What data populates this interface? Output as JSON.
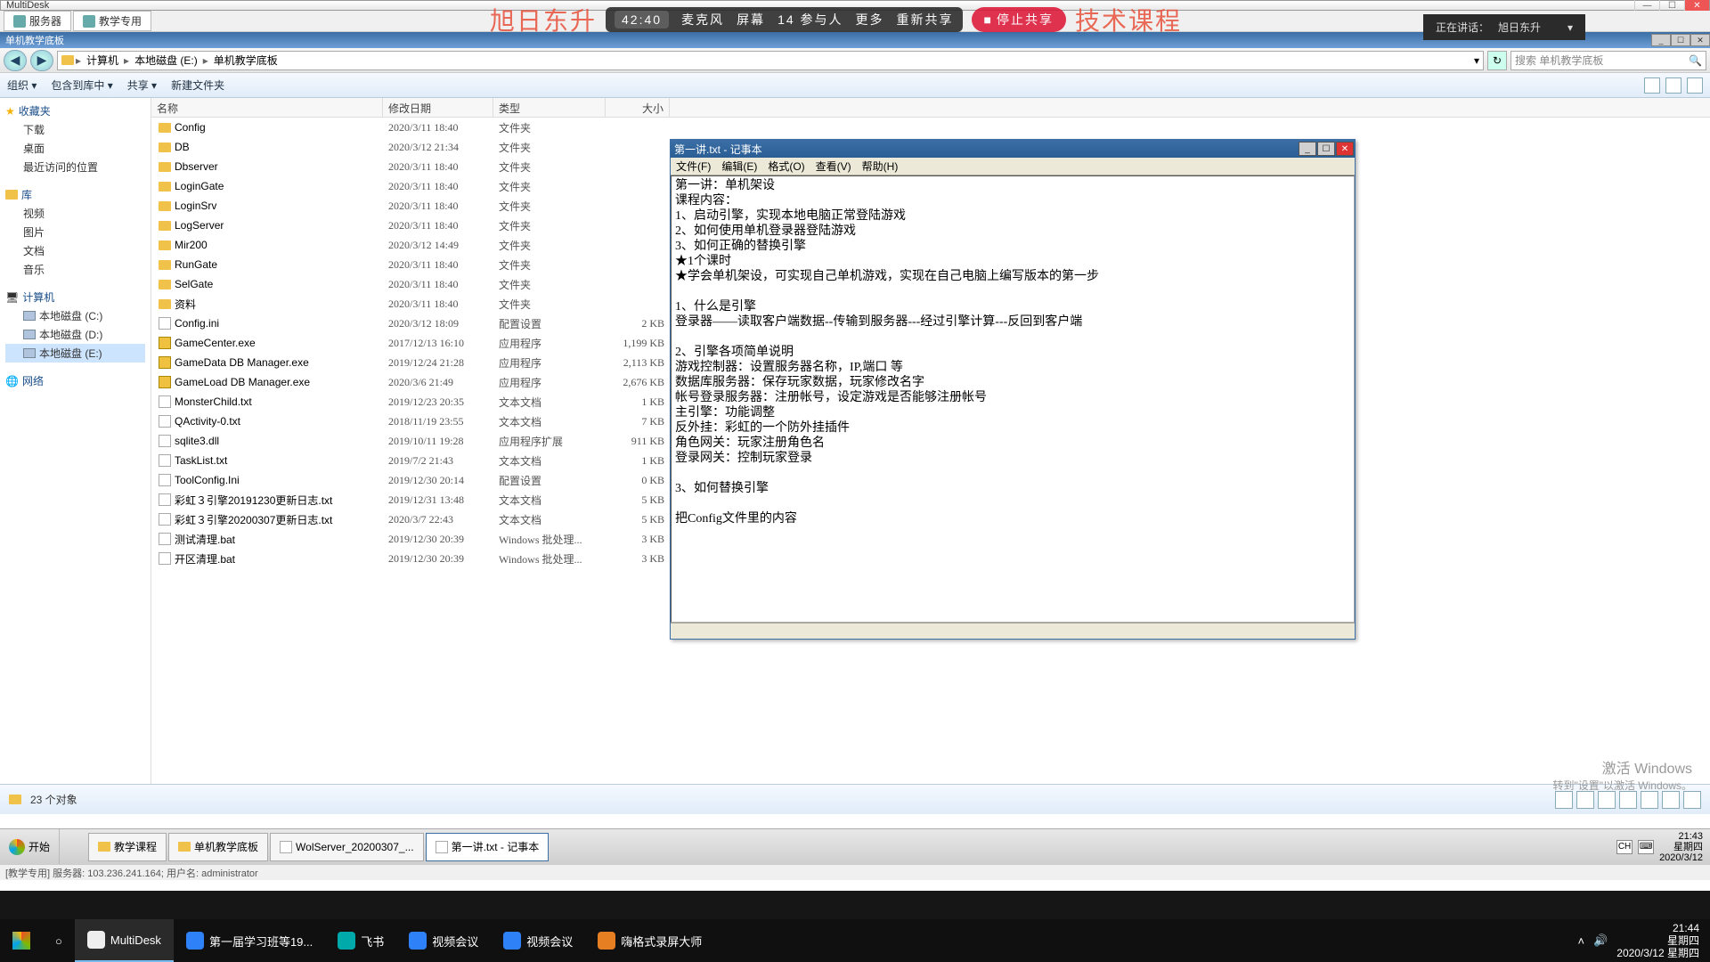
{
  "multidesk": {
    "title": "MultiDesk",
    "tabs": {
      "servers": "服务器",
      "teaching": "教学专用"
    }
  },
  "watermark": {
    "left": "旭日东升",
    "right": "技术课程",
    "timer": "42:40",
    "mic": "麦克风",
    "screen": "屏幕",
    "participants_count": "14",
    "participants": "参与人",
    "more": "更多",
    "reshare": "重新共享",
    "stop": "停止共享"
  },
  "presenter": {
    "label": "正在讲话：",
    "name": "旭日东升"
  },
  "inner": {
    "title": "单机教学底板"
  },
  "breadcrumb": {
    "segs": [
      "计算机",
      "本地磁盘 (E:)",
      "单机教学底板"
    ]
  },
  "search": {
    "placeholder": "搜索 单机教学底板"
  },
  "toolbar": {
    "organize": "组织 ▾",
    "include": "包含到库中 ▾",
    "share": "共享 ▾",
    "newfolder": "新建文件夹"
  },
  "nav": {
    "favorites": "收藏夹",
    "downloads": "下载",
    "desktop": "桌面",
    "recent": "最近访问的位置",
    "libraries": "库",
    "videos": "视频",
    "pictures": "图片",
    "documents": "文档",
    "music": "音乐",
    "computer": "计算机",
    "drive_c": "本地磁盘 (C:)",
    "drive_d": "本地磁盘 (D:)",
    "drive_e": "本地磁盘 (E:)",
    "network": "网络"
  },
  "columns": {
    "name": "名称",
    "date": "修改日期",
    "type": "类型",
    "size": "大小"
  },
  "files": [
    {
      "ic": "folder",
      "name": "Config",
      "date": "2020/3/11 18:40",
      "type": "文件夹",
      "size": ""
    },
    {
      "ic": "folder",
      "name": "DB",
      "date": "2020/3/12 21:34",
      "type": "文件夹",
      "size": ""
    },
    {
      "ic": "folder",
      "name": "Dbserver",
      "date": "2020/3/11 18:40",
      "type": "文件夹",
      "size": ""
    },
    {
      "ic": "folder",
      "name": "LoginGate",
      "date": "2020/3/11 18:40",
      "type": "文件夹",
      "size": ""
    },
    {
      "ic": "folder",
      "name": "LoginSrv",
      "date": "2020/3/11 18:40",
      "type": "文件夹",
      "size": ""
    },
    {
      "ic": "folder",
      "name": "LogServer",
      "date": "2020/3/11 18:40",
      "type": "文件夹",
      "size": ""
    },
    {
      "ic": "folder",
      "name": "Mir200",
      "date": "2020/3/12 14:49",
      "type": "文件夹",
      "size": ""
    },
    {
      "ic": "folder",
      "name": "RunGate",
      "date": "2020/3/11 18:40",
      "type": "文件夹",
      "size": ""
    },
    {
      "ic": "folder",
      "name": "SelGate",
      "date": "2020/3/11 18:40",
      "type": "文件夹",
      "size": ""
    },
    {
      "ic": "folder",
      "name": "资料",
      "date": "2020/3/11 18:40",
      "type": "文件夹",
      "size": ""
    },
    {
      "ic": "file",
      "name": "Config.ini",
      "date": "2020/3/12 18:09",
      "type": "配置设置",
      "size": "2 KB"
    },
    {
      "ic": "exe",
      "name": "GameCenter.exe",
      "date": "2017/12/13 16:10",
      "type": "应用程序",
      "size": "1,199 KB"
    },
    {
      "ic": "exe",
      "name": "GameData DB Manager.exe",
      "date": "2019/12/24 21:28",
      "type": "应用程序",
      "size": "2,113 KB"
    },
    {
      "ic": "exe",
      "name": "GameLoad DB Manager.exe",
      "date": "2020/3/6 21:49",
      "type": "应用程序",
      "size": "2,676 KB"
    },
    {
      "ic": "file",
      "name": "MonsterChild.txt",
      "date": "2019/12/23 20:35",
      "type": "文本文档",
      "size": "1 KB"
    },
    {
      "ic": "file",
      "name": "QActivity-0.txt",
      "date": "2018/11/19 23:55",
      "type": "文本文档",
      "size": "7 KB"
    },
    {
      "ic": "file",
      "name": "sqlite3.dll",
      "date": "2019/10/11 19:28",
      "type": "应用程序扩展",
      "size": "911 KB"
    },
    {
      "ic": "file",
      "name": "TaskList.txt",
      "date": "2019/7/2 21:43",
      "type": "文本文档",
      "size": "1 KB"
    },
    {
      "ic": "file",
      "name": "ToolConfig.Ini",
      "date": "2019/12/30 20:14",
      "type": "配置设置",
      "size": "0 KB"
    },
    {
      "ic": "file",
      "name": "彩虹３引擎20191230更新日志.txt",
      "date": "2019/12/31 13:48",
      "type": "文本文档",
      "size": "5 KB"
    },
    {
      "ic": "file",
      "name": "彩虹３引擎20200307更新日志.txt",
      "date": "2020/3/7 22:43",
      "type": "文本文档",
      "size": "5 KB"
    },
    {
      "ic": "file",
      "name": "测试清理.bat",
      "date": "2019/12/30 20:39",
      "type": "Windows 批处理...",
      "size": "3 KB"
    },
    {
      "ic": "file",
      "name": "开区清理.bat",
      "date": "2019/12/30 20:39",
      "type": "Windows 批处理...",
      "size": "3 KB"
    }
  ],
  "status": {
    "count": "23 个对象"
  },
  "notepad": {
    "title": "第一讲.txt - 记事本",
    "menu": [
      "文件(F)",
      "编辑(E)",
      "格式(O)",
      "查看(V)",
      "帮助(H)"
    ],
    "content": "第一讲：单机架设\n课程内容：\n1、启动引擎，实现本地电脑正常登陆游戏\n2、如何使用单机登录器登陆游戏\n3、如何正确的替换引擎\n★1个课时\n★学会单机架设，可实现自己单机游戏，实现在自己电脑上编写版本的第一步\n\n1、什么是引擎\n登录器——读取客户端数据--传输到服务器---经过引擎计算---反回到客户端\n\n2、引擎各项简单说明\n游戏控制器：设置服务器名称，IP,端口 等\n数据库服务器：保存玩家数据，玩家修改名字\n帐号登录服务器：注册帐号，设定游戏是否能够注册帐号\n主引擎：功能调整\n反外挂：彩虹的一个防外挂插件\n角色网关：玩家注册角色名\n登录网关：控制玩家登录\n\n3、如何替换引擎\n\n把Config文件里的内容"
  },
  "remote_taskbar": {
    "start": "开始",
    "items": [
      "教学课程",
      "单机教学底板",
      "WolServer_20200307_...",
      "第一讲.txt - 记事本"
    ],
    "lang": "CH",
    "time": "21:43",
    "day": "星期四",
    "date": "2020/3/12"
  },
  "activate": {
    "title": "激活 Windows",
    "sub": "转到\"设置\"以激活 Windows。"
  },
  "remote_status": "[教学专用] 服务器: 103.236.241.164; 用户名: administrator",
  "host_taskbar": {
    "items": [
      "MultiDesk",
      "第一届学习班等19...",
      "飞书",
      "视频会议",
      "视频会议",
      "嗨格式录屏大师"
    ],
    "time": "21:44",
    "day": "星期四",
    "date": "2020/3/12 星期四"
  }
}
